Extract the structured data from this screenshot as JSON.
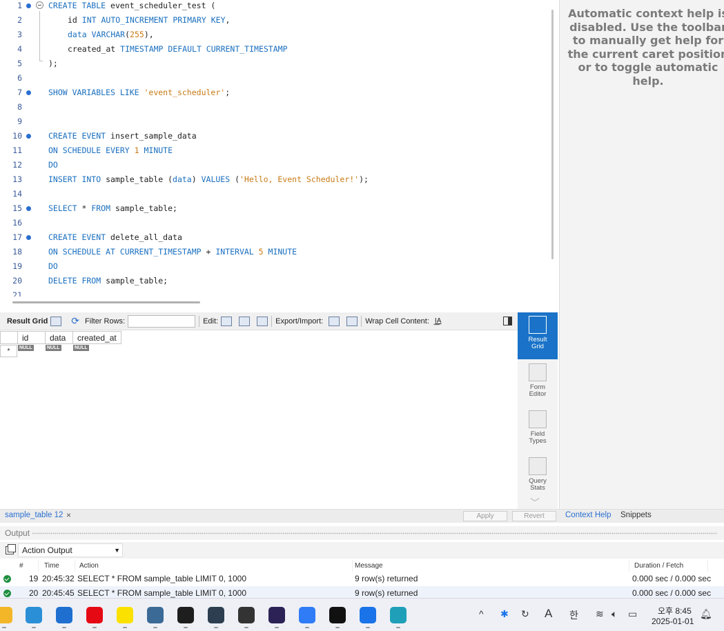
{
  "editor": {
    "lines": [
      {
        "n": "1",
        "marker": true,
        "fold": true,
        "indent": 0,
        "tokens": [
          {
            "t": "CREATE TABLE",
            "c": "kw"
          },
          {
            "t": " event_scheduler_test (",
            "c": ""
          }
        ]
      },
      {
        "n": "2",
        "marker": false,
        "fold": false,
        "indent": 4,
        "tokens": [
          {
            "t": "id ",
            "c": ""
          },
          {
            "t": "INT AUTO_INCREMENT PRIMARY KEY",
            "c": "kw"
          },
          {
            "t": ",",
            "c": ""
          }
        ]
      },
      {
        "n": "3",
        "marker": false,
        "fold": false,
        "indent": 4,
        "tokens": [
          {
            "t": "data ",
            "c": "kw"
          },
          {
            "t": "VARCHAR",
            "c": "kw"
          },
          {
            "t": "(",
            "c": ""
          },
          {
            "t": "255",
            "c": "num"
          },
          {
            "t": "),",
            "c": ""
          }
        ]
      },
      {
        "n": "4",
        "marker": false,
        "fold": false,
        "indent": 4,
        "tokens": [
          {
            "t": "created_at ",
            "c": ""
          },
          {
            "t": "TIMESTAMP DEFAULT CURRENT_TIMESTAMP",
            "c": "kw"
          }
        ]
      },
      {
        "n": "5",
        "marker": false,
        "fold": false,
        "indent": 0,
        "tokens": [
          {
            "t": ");",
            "c": ""
          }
        ]
      },
      {
        "n": "6",
        "marker": false,
        "fold": false,
        "indent": 0,
        "tokens": []
      },
      {
        "n": "7",
        "marker": true,
        "fold": false,
        "indent": 0,
        "tokens": [
          {
            "t": "SHOW VARIABLES LIKE ",
            "c": "kw"
          },
          {
            "t": "'event_scheduler'",
            "c": "str"
          },
          {
            "t": ";",
            "c": ""
          }
        ]
      },
      {
        "n": "8",
        "marker": false,
        "fold": false,
        "indent": 0,
        "tokens": []
      },
      {
        "n": "9",
        "marker": false,
        "fold": false,
        "indent": 0,
        "tokens": []
      },
      {
        "n": "10",
        "marker": true,
        "fold": false,
        "indent": 0,
        "tokens": [
          {
            "t": "CREATE EVENT",
            "c": "kw"
          },
          {
            "t": " insert_sample_data",
            "c": ""
          }
        ]
      },
      {
        "n": "11",
        "marker": false,
        "fold": false,
        "indent": 0,
        "tokens": [
          {
            "t": "ON SCHEDULE EVERY ",
            "c": "kw"
          },
          {
            "t": "1",
            "c": "num"
          },
          {
            "t": " MINUTE",
            "c": "kw"
          }
        ]
      },
      {
        "n": "12",
        "marker": false,
        "fold": false,
        "indent": 0,
        "tokens": [
          {
            "t": "DO",
            "c": "kw"
          }
        ]
      },
      {
        "n": "13",
        "marker": false,
        "fold": false,
        "indent": 0,
        "tokens": [
          {
            "t": "INSERT INTO",
            "c": "kw"
          },
          {
            "t": " sample_table (",
            "c": ""
          },
          {
            "t": "data",
            "c": "kw"
          },
          {
            "t": ") ",
            "c": ""
          },
          {
            "t": "VALUES",
            "c": "kw"
          },
          {
            "t": " (",
            "c": ""
          },
          {
            "t": "'Hello, Event Scheduler!'",
            "c": "str"
          },
          {
            "t": ");",
            "c": ""
          }
        ]
      },
      {
        "n": "14",
        "marker": false,
        "fold": false,
        "indent": 0,
        "tokens": []
      },
      {
        "n": "15",
        "marker": true,
        "fold": false,
        "indent": 0,
        "tokens": [
          {
            "t": "SELECT",
            "c": "kw"
          },
          {
            "t": " * ",
            "c": ""
          },
          {
            "t": "FROM",
            "c": "kw"
          },
          {
            "t": " sample_table;",
            "c": ""
          }
        ]
      },
      {
        "n": "16",
        "marker": false,
        "fold": false,
        "indent": 0,
        "tokens": []
      },
      {
        "n": "17",
        "marker": true,
        "fold": false,
        "indent": 0,
        "tokens": [
          {
            "t": "CREATE EVENT",
            "c": "kw"
          },
          {
            "t": " delete_all_data",
            "c": ""
          }
        ]
      },
      {
        "n": "18",
        "marker": false,
        "fold": false,
        "indent": 0,
        "tokens": [
          {
            "t": "ON SCHEDULE AT CURRENT_TIMESTAMP",
            "c": "kw"
          },
          {
            "t": " + ",
            "c": ""
          },
          {
            "t": "INTERVAL ",
            "c": "kw"
          },
          {
            "t": "5",
            "c": "num"
          },
          {
            "t": " MINUTE",
            "c": "kw"
          }
        ]
      },
      {
        "n": "19",
        "marker": false,
        "fold": false,
        "indent": 0,
        "tokens": [
          {
            "t": "DO",
            "c": "kw"
          }
        ]
      },
      {
        "n": "20",
        "marker": false,
        "fold": false,
        "indent": 0,
        "tokens": [
          {
            "t": "DELETE FROM",
            "c": "kw"
          },
          {
            "t": " sample_table;",
            "c": ""
          }
        ]
      },
      {
        "n": "21",
        "marker": false,
        "fold": false,
        "indent": 0,
        "tokens": []
      }
    ]
  },
  "context_help": {
    "text": "Automatic context help is disabled. Use the toolbar to manually get help for the current caret position or to toggle automatic help."
  },
  "result_toolbar": {
    "result_grid": "Result Grid",
    "filter_rows": "Filter Rows:",
    "filter_value": "",
    "edit": "Edit:",
    "export_import": "Export/Import:",
    "wrap_cell": "Wrap Cell Content:"
  },
  "grid": {
    "columns": [
      "id",
      "data",
      "created_at"
    ],
    "null_label": "NULL",
    "new_row_marker": "*"
  },
  "side_switcher": {
    "result_grid": [
      "Result",
      "Grid"
    ],
    "form_editor": [
      "Form",
      "Editor"
    ],
    "field_types": [
      "Field",
      "Types"
    ],
    "query_stats": [
      "Query",
      "Stats"
    ]
  },
  "bottom_tabs": {
    "result_tab": "sample_table 12",
    "close": "×",
    "apply": "Apply",
    "revert": "Revert",
    "context_help": "Context Help",
    "snippets": "Snippets"
  },
  "output": {
    "label": "Output",
    "select_value": "Action Output",
    "headers": [
      "#",
      "Time",
      "Action",
      "Message",
      "Duration / Fetch"
    ],
    "rows": [
      {
        "num": "19",
        "time": "20:45:32",
        "action": "SELECT * FROM sample_table LIMIT 0, 1000",
        "message": "9 row(s) returned",
        "duration": "0.000 sec / 0.000 sec"
      },
      {
        "num": "20",
        "time": "20:45:45",
        "action": "SELECT * FROM sample_table LIMIT 0, 1000",
        "message": "9 row(s) returned",
        "duration": "0.000 sec / 0.000 sec"
      }
    ]
  },
  "taskbar": {
    "apps": [
      {
        "name": "file-explorer-icon",
        "color": "#f2b628"
      },
      {
        "name": "browser-icon",
        "color": "#2a8fd6"
      },
      {
        "name": "app-window-icon",
        "color": "#1e6fd0"
      },
      {
        "name": "netflix-icon",
        "color": "#e50914"
      },
      {
        "name": "kakaotalk-icon",
        "color": "#fae100"
      },
      {
        "name": "mysql-workbench-icon",
        "color": "#3a6a95"
      },
      {
        "name": "figma-icon",
        "color": "#1e1e1e"
      },
      {
        "name": "circle-app-icon",
        "color": "#2c3e50"
      },
      {
        "name": "capture-tool-icon",
        "color": "#333333"
      },
      {
        "name": "eclipse-icon",
        "color": "#2c2255"
      },
      {
        "name": "app-store-icon",
        "color": "#2f7cf6"
      },
      {
        "name": "webstorm-icon",
        "color": "#111111"
      },
      {
        "name": "maps-icon",
        "color": "#1a73e8"
      },
      {
        "name": "edge-icon",
        "color": "#1fa0b8"
      }
    ],
    "tray": {
      "chevron": "^",
      "ime_letter": "A",
      "ime_hangul": "한",
      "time": "오후 8:45",
      "date": "2025-01-01"
    }
  }
}
